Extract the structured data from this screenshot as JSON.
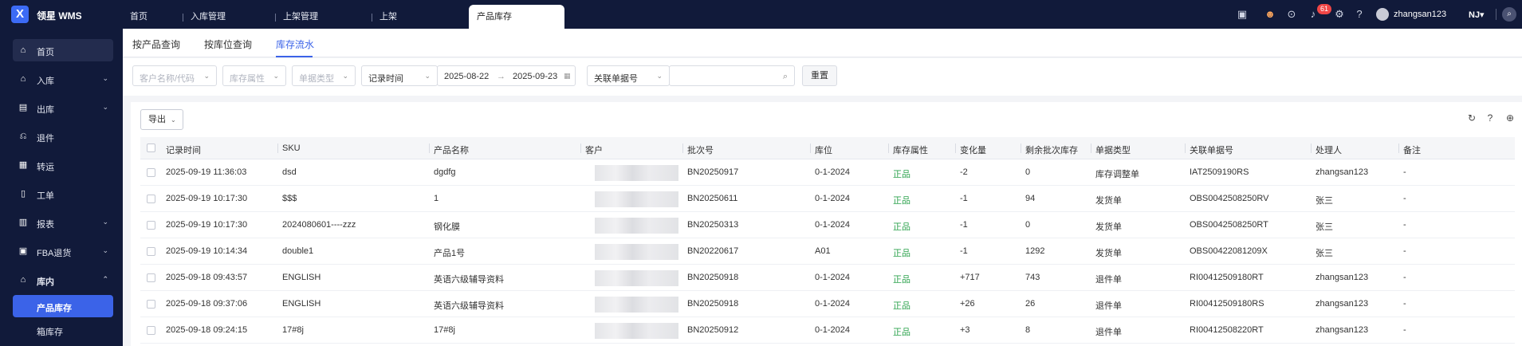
{
  "app": {
    "brand": "领星 WMS",
    "logo_letter": "X"
  },
  "nav": {
    "tabs": [
      "首页",
      "入库管理",
      "上架管理",
      "上架",
      "产品库存"
    ],
    "active_tab": "产品库存"
  },
  "topbar": {
    "notification_count": "61",
    "username": "zhangsan123",
    "region": "NJ▾"
  },
  "sidebar": {
    "items": [
      {
        "label": "首页",
        "icon": "home-icon"
      },
      {
        "label": "入库",
        "icon": "inbound-icon"
      },
      {
        "label": "出库",
        "icon": "outbound-icon"
      },
      {
        "label": "退件",
        "icon": "return-icon"
      },
      {
        "label": "转运",
        "icon": "transfer-icon"
      },
      {
        "label": "工单",
        "icon": "work-order-icon"
      },
      {
        "label": "报表",
        "icon": "report-icon"
      },
      {
        "label": "FBA退货",
        "icon": "fba-return-icon"
      },
      {
        "label": "库内",
        "icon": "warehouse-icon"
      }
    ],
    "sub_items": [
      "产品库存",
      "箱库存"
    ]
  },
  "subtabs": [
    "按产品查询",
    "按库位查询",
    "库存流水"
  ],
  "filters": {
    "customer_placeholder": "客户名称/代码",
    "inventory_attr_placeholder": "库存属性",
    "doc_type_placeholder": "单据类型",
    "time_type": "记录时间",
    "date_start": "2025-08-22",
    "date_arrow": "→",
    "date_end": "2025-09-23",
    "related_type": "关联单据号",
    "reset_label": "重置"
  },
  "toolbar": {
    "export_label": "导出"
  },
  "table": {
    "columns": [
      "记录时间",
      "SKU",
      "产品名称",
      "客户",
      "批次号",
      "库位",
      "库存属性",
      "变化量",
      "剩余批次库存",
      "单据类型",
      "关联单据号",
      "处理人",
      "备注"
    ],
    "rows": [
      [
        "2025-09-19 11:36:03",
        "dsd",
        "dgdfg",
        "",
        "BN20250917",
        "0-1-2024",
        "正品",
        "-2",
        "0",
        "库存调整单",
        "IAT2509190RS",
        "zhangsan123",
        "-"
      ],
      [
        "2025-09-19 10:17:30",
        "$$$",
        "1",
        "",
        "BN20250611",
        "0-1-2024",
        "正品",
        "-1",
        "94",
        "发货单",
        "OBS0042508250RV",
        "张三",
        "-"
      ],
      [
        "2025-09-19 10:17:30",
        "2024080601----zzz",
        "钢化膜",
        "",
        "BN20250313",
        "0-1-2024",
        "正品",
        "-1",
        "0",
        "发货单",
        "OBS0042508250RT",
        "张三",
        "-"
      ],
      [
        "2025-09-19 10:14:34",
        "double1",
        "产品1号",
        "",
        "BN20220617",
        "A01",
        "正品",
        "-1",
        "1292",
        "发货单",
        "OBS00422081209X",
        "张三",
        "-"
      ],
      [
        "2025-09-18 09:43:57",
        "ENGLISH",
        "英语六级辅导资料",
        "",
        "BN20250918",
        "0-1-2024",
        "正品",
        "+717",
        "743",
        "退件单",
        "RI00412509180RT",
        "zhangsan123",
        "-"
      ],
      [
        "2025-09-18 09:37:06",
        "ENGLISH",
        "英语六级辅导资料",
        "",
        "BN20250918",
        "0-1-2024",
        "正品",
        "+26",
        "26",
        "退件单",
        "RI00412509180RS",
        "zhangsan123",
        "-"
      ],
      [
        "2025-09-18 09:24:15",
        "17#8j",
        "17#8j",
        "",
        "BN20250912",
        "0-1-2024",
        "正品",
        "+3",
        "8",
        "退件单",
        "RI00412508220RT",
        "zhangsan123",
        "-"
      ]
    ]
  },
  "colors": {
    "nav_bg": "#111a3a",
    "accent": "#3b63e8",
    "positive": "#2ba24c",
    "badge": "#f04646"
  }
}
